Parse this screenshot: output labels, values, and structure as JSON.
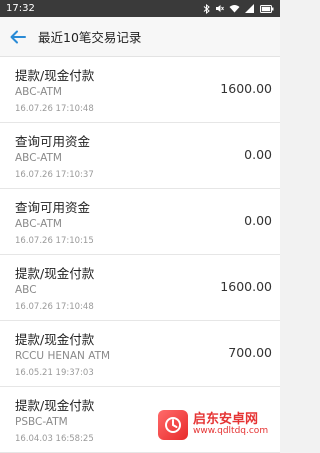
{
  "status": {
    "time": "17:32"
  },
  "header": {
    "title": "最近10笔交易记录"
  },
  "transactions": [
    {
      "title": "提款/现金付款",
      "channel": "ABC-ATM",
      "time": "16.07.26 17:10:48",
      "amount": "1600.00"
    },
    {
      "title": "查询可用资金",
      "channel": "ABC-ATM",
      "time": "16.07.26 17:10:37",
      "amount": "0.00"
    },
    {
      "title": "查询可用资金",
      "channel": "ABC-ATM",
      "time": "16.07.26 17:10:15",
      "amount": "0.00"
    },
    {
      "title": "提款/现金付款",
      "channel": "ABC",
      "time": "16.07.26 17:10:48",
      "amount": "1600.00"
    },
    {
      "title": "提款/现金付款",
      "channel": "RCCU HENAN ATM",
      "time": "16.05.21 19:37:03",
      "amount": "700.00"
    },
    {
      "title": "提款/现金付款",
      "channel": "PSBC-ATM",
      "time": "16.04.03 16:58:25",
      "amount": ""
    }
  ],
  "watermark": {
    "name": "启东安卓网",
    "url": "www.qdltdq.com"
  },
  "colors": {
    "accent": "#2a8bd6",
    "watermark": "#e53333"
  }
}
